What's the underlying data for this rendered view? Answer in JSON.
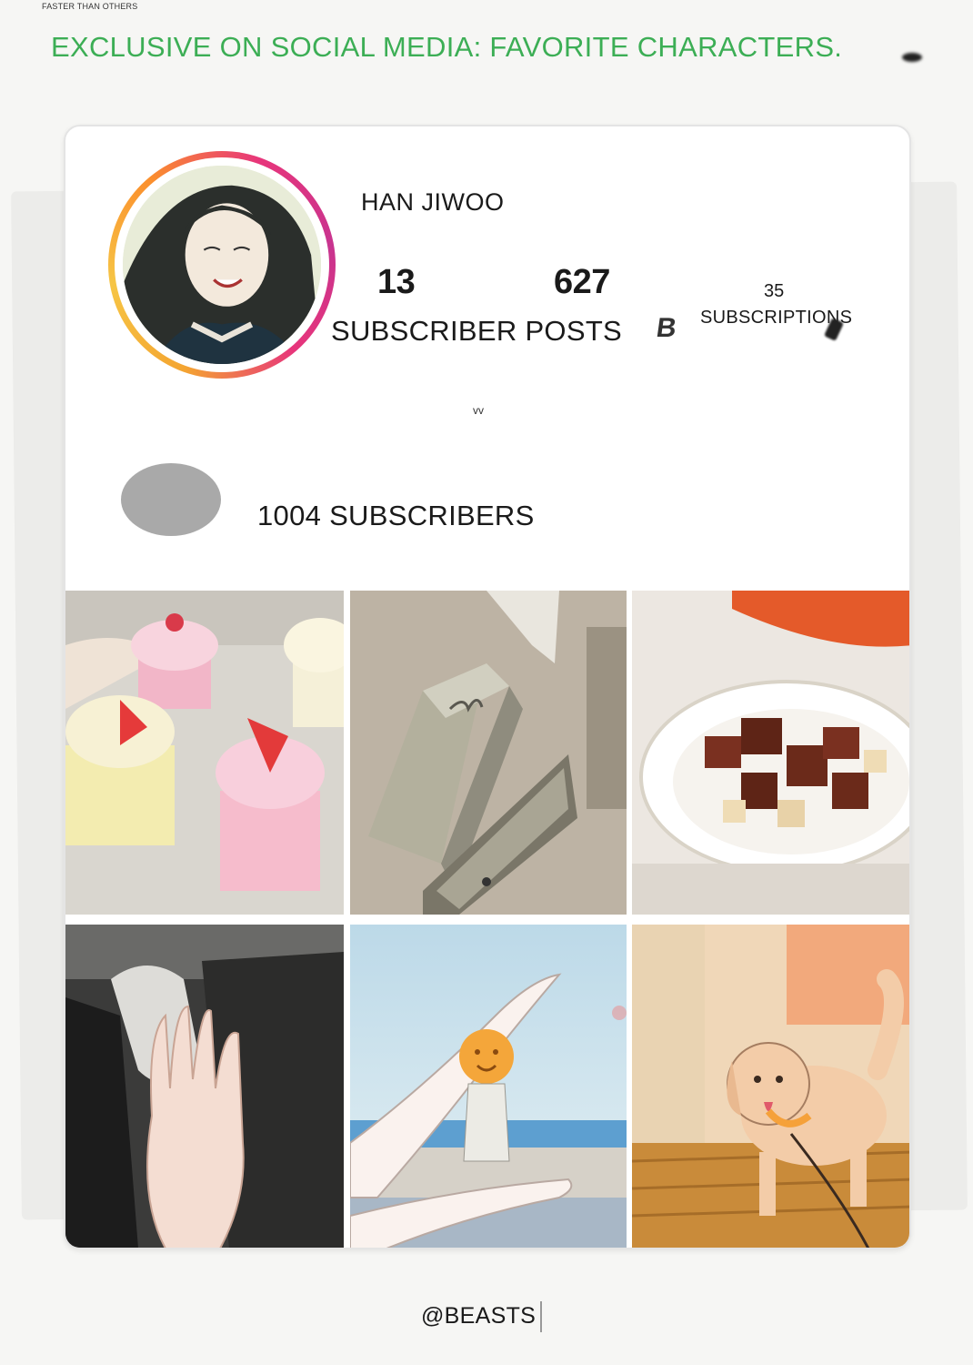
{
  "watermark": "FASTER THAN OTHERS",
  "headline": "EXCLUSIVE ON SOCIAL MEDIA: FAVORITE CHARACTERS.",
  "profile": {
    "username": "HAN JIWOO",
    "stat1_value": "13",
    "stat2_value": "627",
    "stats_labels": "SUBSCRIBER POSTS",
    "scribble": "B",
    "subscriptions_value": "35",
    "subscriptions_label": "SUBSCRIPTIONS",
    "small_text": "vv"
  },
  "follower_row": {
    "text": "1004 SUBSCRIBERS"
  },
  "grid": {
    "posts": [
      {
        "icon": "cupcakes-image"
      },
      {
        "icon": "gift-box-image"
      },
      {
        "icon": "braised-meat-dish-image"
      },
      {
        "icon": "hand-on-book-image"
      },
      {
        "icon": "beach-figure-in-hand-image"
      },
      {
        "icon": "puppy-on-leash-image"
      }
    ]
  },
  "footer": {
    "handle": "@BEASTS"
  },
  "colors": {
    "headline": "#3cae55",
    "ring_start": "#f4a531",
    "ring_end": "#e7357b",
    "grey_avatar": "#a9a9a9"
  }
}
